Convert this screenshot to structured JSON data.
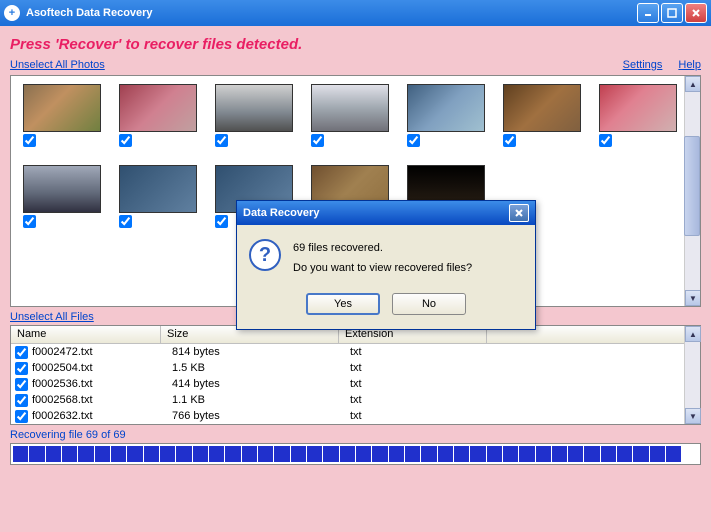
{
  "window": {
    "title": "Asoftech Data Recovery"
  },
  "instruction": "Press 'Recover' to recover files detected.",
  "links": {
    "unselect_photos": "Unselect All Photos",
    "unselect_files": "Unselect All Files",
    "settings": "Settings",
    "help": "Help"
  },
  "columns": {
    "name": "Name",
    "size": "Size",
    "ext": "Extension"
  },
  "files": [
    {
      "name": "f0002472.txt",
      "size": "814 bytes",
      "ext": "txt"
    },
    {
      "name": "f0002504.txt",
      "size": "1.5 KB",
      "ext": "txt"
    },
    {
      "name": "f0002536.txt",
      "size": "414 bytes",
      "ext": "txt"
    },
    {
      "name": "f0002568.txt",
      "size": "1.1 KB",
      "ext": "txt"
    },
    {
      "name": "f0002632.txt",
      "size": "766 bytes",
      "ext": "txt"
    }
  ],
  "status": "Recovering file 69 of 69",
  "dialog": {
    "title": "Data Recovery",
    "line1": "69 files recovered.",
    "line2": "Do you want to view recovered files?",
    "yes": "Yes",
    "no": "No"
  }
}
